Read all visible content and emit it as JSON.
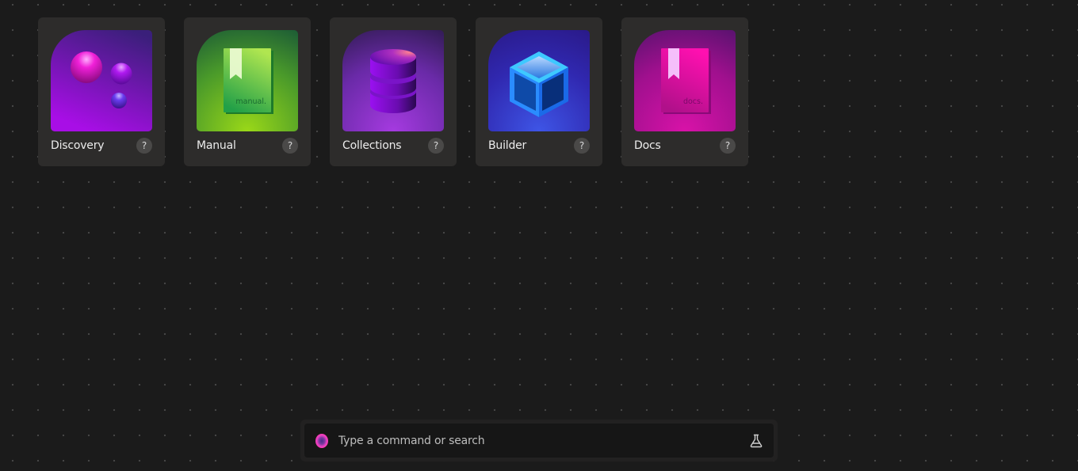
{
  "cards": [
    {
      "label": "Discovery",
      "help": "?",
      "icon": "bubbles-icon",
      "colors": {
        "top": "#3a1f7a",
        "bottom": "#a30fe0"
      }
    },
    {
      "label": "Manual",
      "help": "?",
      "icon": "manual-book-icon",
      "book_text": "manual.",
      "colors": {
        "top": "#1f5f35",
        "bottom": "#8fd21a"
      }
    },
    {
      "label": "Collections",
      "help": "?",
      "icon": "database-icon",
      "colors": {
        "top": "#3a1e5e",
        "bottom": "#9b30d8"
      }
    },
    {
      "label": "Builder",
      "help": "?",
      "icon": "cube-icon",
      "colors": {
        "top": "#2a1a8a",
        "bottom": "#3d4fe0"
      }
    },
    {
      "label": "Docs",
      "help": "?",
      "icon": "docs-book-icon",
      "book_text": "docs.",
      "colors": {
        "top": "#5e1270",
        "bottom": "#d010a0"
      }
    }
  ],
  "command_bar": {
    "placeholder": "Type a command or search",
    "value": "",
    "left_icon": "app-logo-icon",
    "right_icon": "flask-icon"
  }
}
